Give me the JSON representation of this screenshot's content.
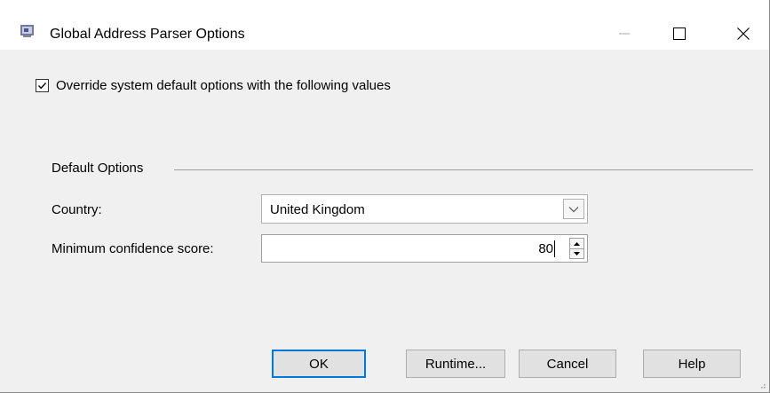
{
  "window": {
    "title": "Global Address Parser Options",
    "icon": "app-icon"
  },
  "titlebar_buttons": {
    "minimize_icon": "minimize-icon",
    "maximize_icon": "maximize-icon",
    "close_icon": "close-icon"
  },
  "override": {
    "label": "Override system default options with the following values",
    "checked": true
  },
  "default_options": {
    "group_label": "Default Options",
    "country_label": "Country:",
    "country_value": "United Kingdom",
    "confidence_label": "Minimum confidence score:",
    "confidence_value": "80"
  },
  "buttons": {
    "ok": "OK",
    "runtime": "Runtime...",
    "cancel": "Cancel",
    "help": "Help"
  },
  "colors": {
    "accent": "#0078d7",
    "background": "#f0f0f0"
  }
}
